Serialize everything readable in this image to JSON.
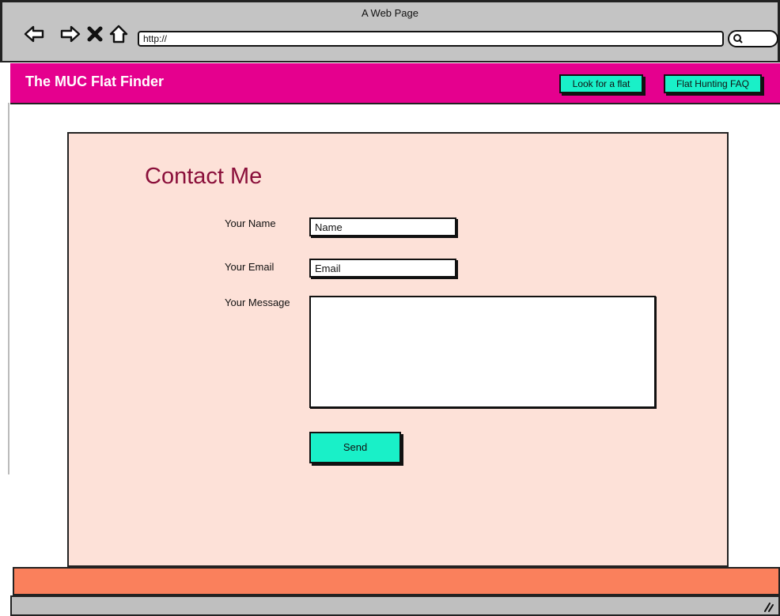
{
  "window": {
    "title": "A Web Page",
    "url": "http://"
  },
  "header": {
    "brand": "The MUC Flat Finder",
    "nav": [
      {
        "label": "Look for a flat"
      },
      {
        "label": "Flat Hunting FAQ"
      }
    ]
  },
  "contact": {
    "title": "Contact Me",
    "name_label": "Your Name",
    "name_value": "Name",
    "email_label": "Your Email",
    "email_value": "Email",
    "message_label": "Your Message",
    "send_label": "Send"
  },
  "colors": {
    "header": "#e5008e",
    "button": "#19f0c8",
    "panel": "#fde1d8",
    "title": "#8a0f3a",
    "footer": "#fa805c"
  },
  "icons": [
    "back-icon",
    "forward-icon",
    "stop-icon",
    "home-icon",
    "search-icon",
    "resize-grip-icon"
  ]
}
